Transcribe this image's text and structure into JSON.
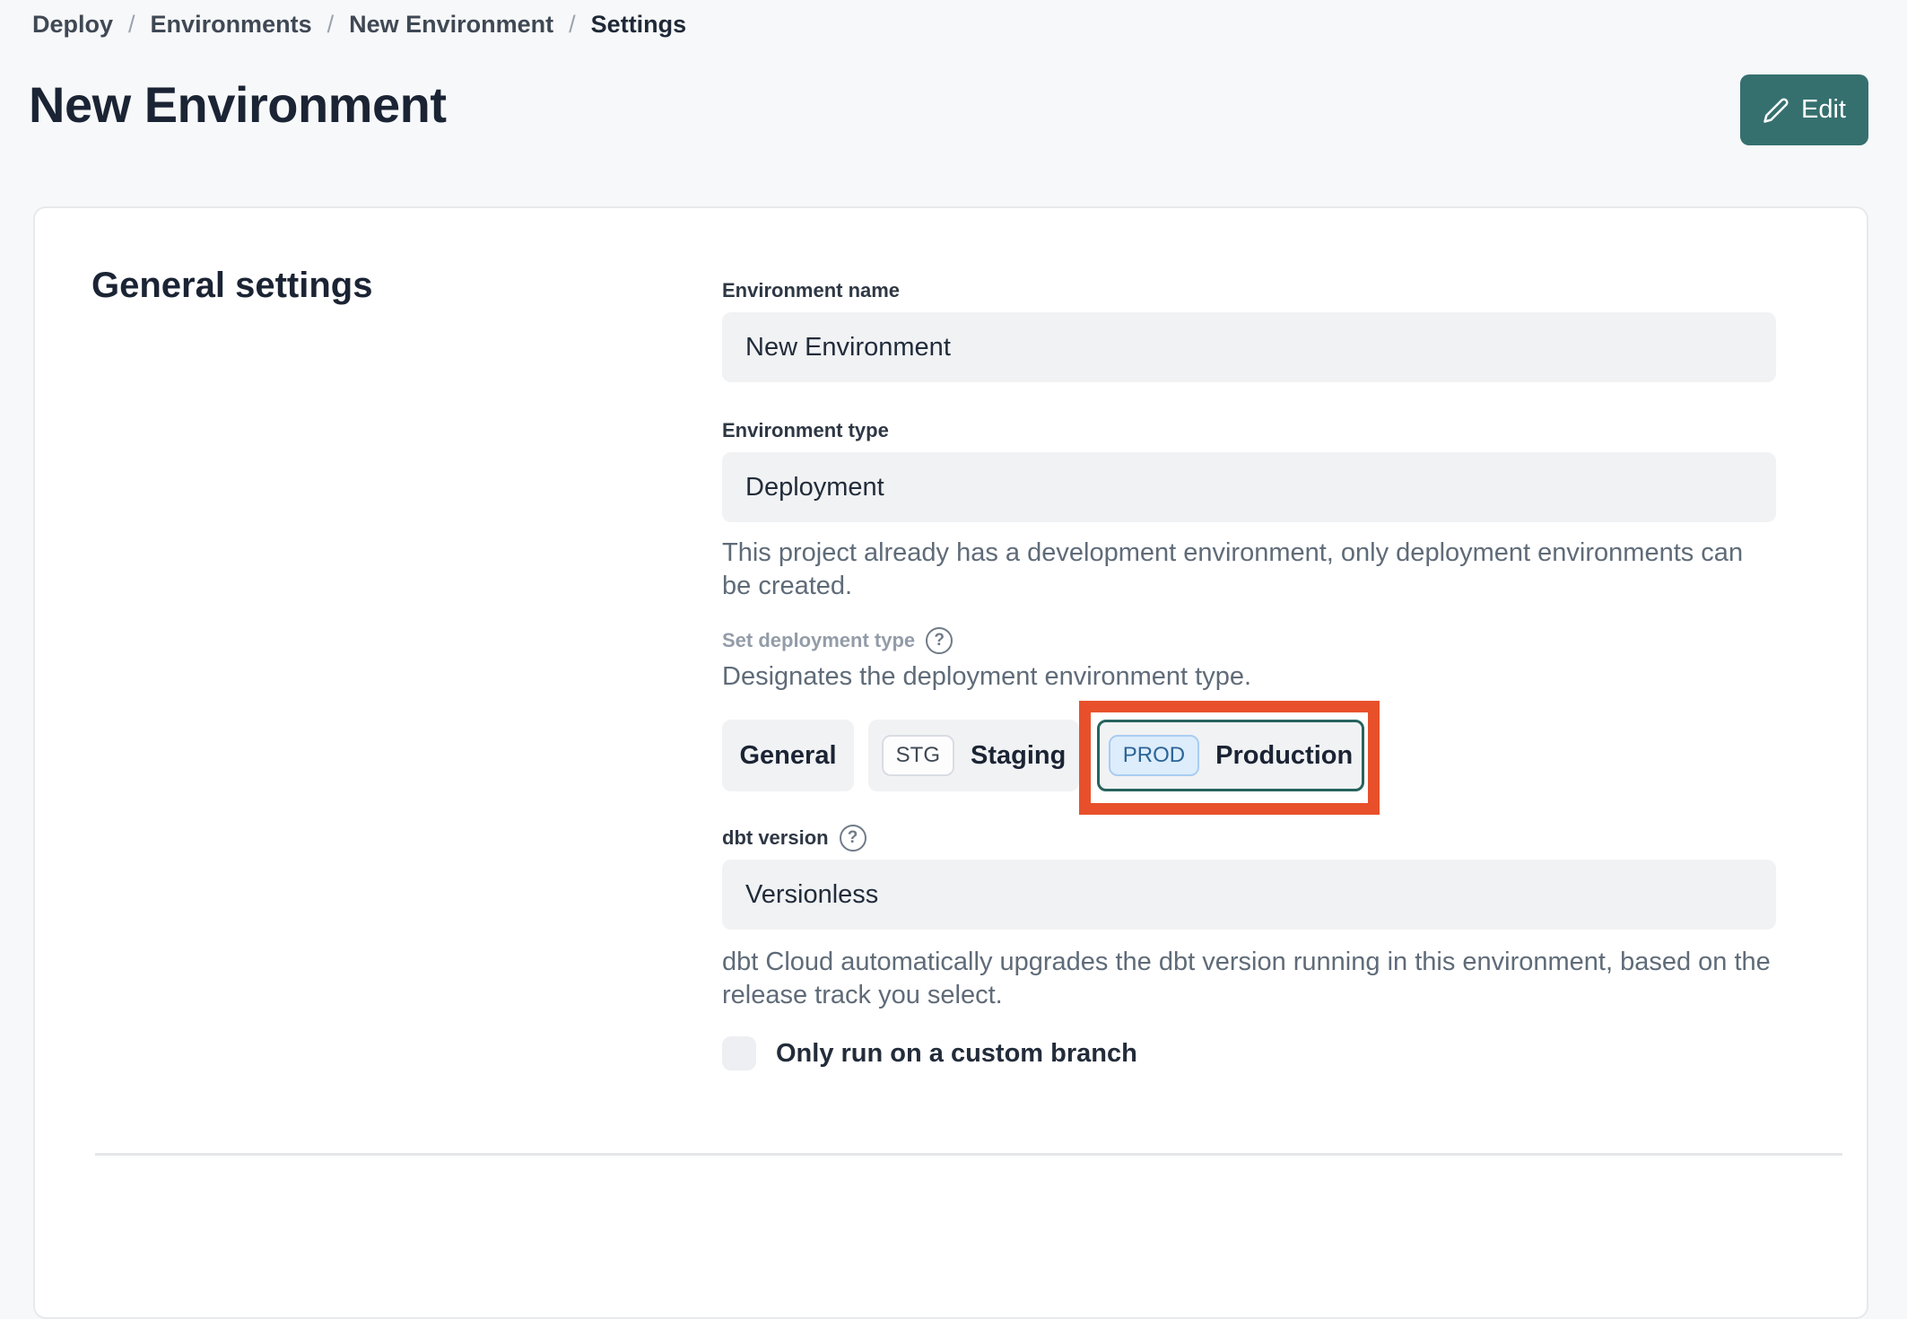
{
  "breadcrumb": {
    "separator": "/",
    "items": [
      {
        "label": "Deploy",
        "current": false
      },
      {
        "label": "Environments",
        "current": false
      },
      {
        "label": "New Environment",
        "current": false
      },
      {
        "label": "Settings",
        "current": true
      }
    ]
  },
  "header": {
    "title": "New Environment",
    "edit_label": "Edit"
  },
  "section": {
    "title": "General settings"
  },
  "fields": {
    "environment_name": {
      "label": "Environment name",
      "value": "New Environment"
    },
    "environment_type": {
      "label": "Environment type",
      "value": "Deployment",
      "help": "This project already has a development environment, only deployment environments can be created."
    },
    "deployment_type": {
      "label": "Set deployment type",
      "description": "Designates the deployment environment type.",
      "options": [
        {
          "label": "General",
          "badge": "",
          "selected": false,
          "highlighted": false
        },
        {
          "label": "Staging",
          "badge": "STG",
          "selected": false,
          "highlighted": false
        },
        {
          "label": "Production",
          "badge": "PROD",
          "selected": true,
          "highlighted": true
        }
      ]
    },
    "dbt_version": {
      "label": "dbt version",
      "value": "Versionless",
      "help": "dbt Cloud automatically upgrades the dbt version running in this environment, based on the release track you select."
    },
    "custom_branch": {
      "label": "Only run on a custom branch",
      "checked": false
    }
  },
  "icons": {
    "edit": "pencil-icon",
    "help": "question-circle-icon"
  },
  "colors": {
    "accent_teal": "#35706f",
    "selected_border_teal": "#26635e",
    "highlight_orange": "#e8502b",
    "prod_badge_bg": "#ddedfc",
    "prod_badge_border": "#a9cdf2",
    "prod_badge_text": "#2b6496"
  }
}
